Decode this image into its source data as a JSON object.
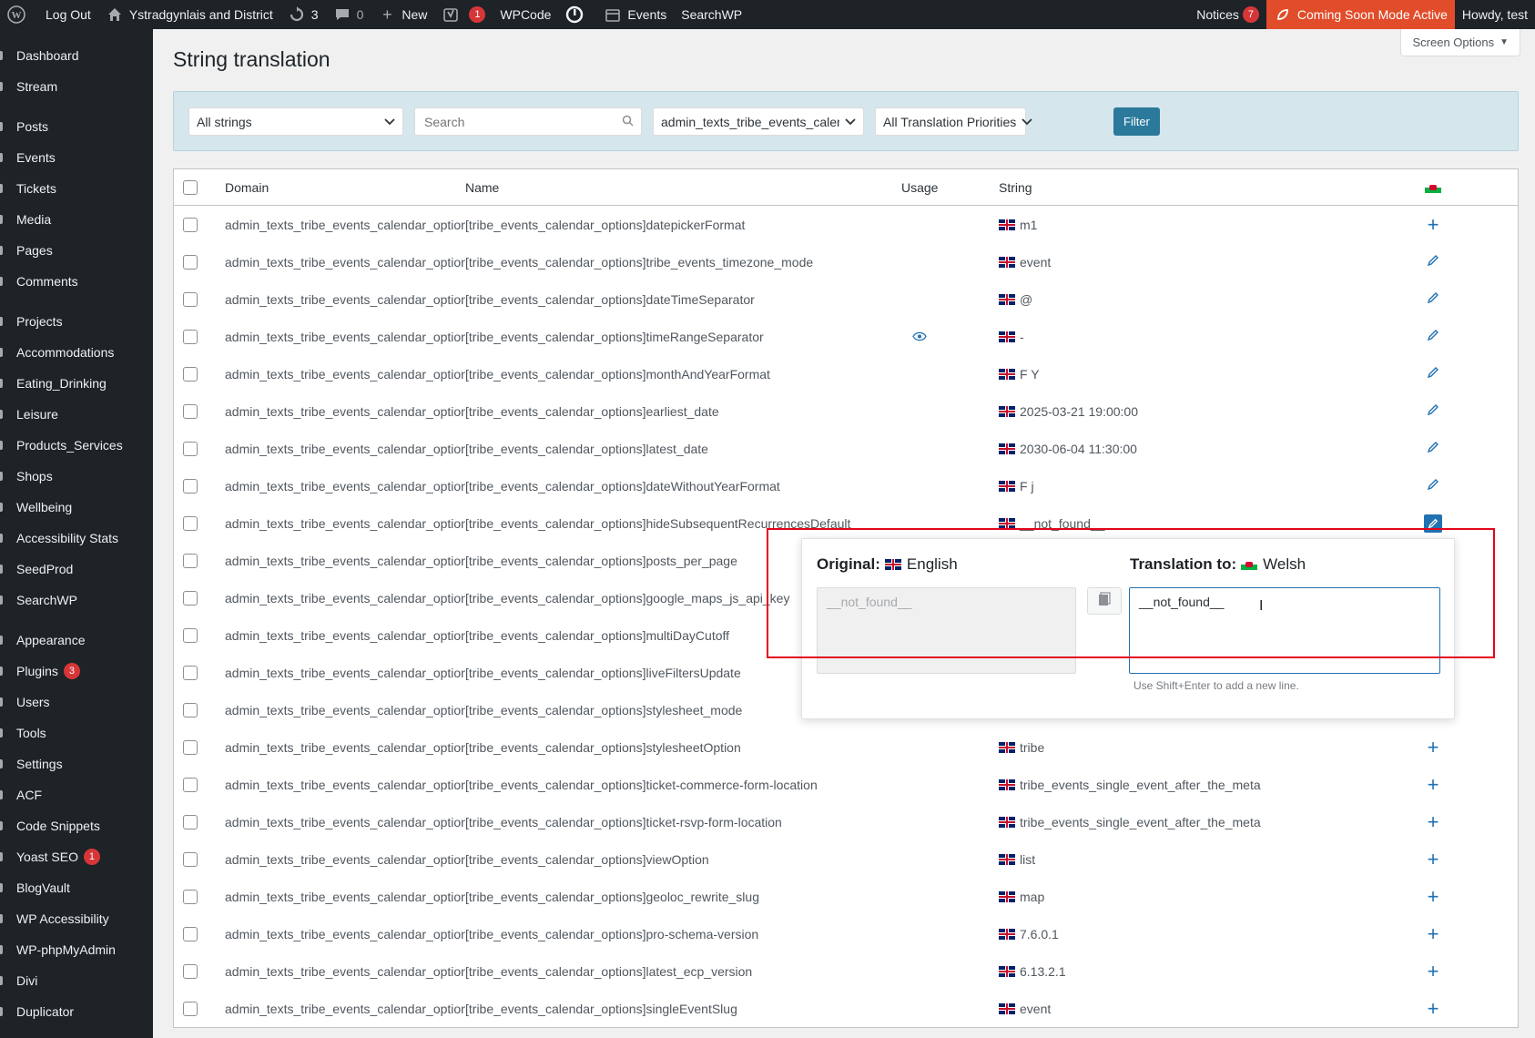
{
  "adminbar": {
    "logout": "Log Out",
    "site_name": "Ystradgynlais and District",
    "updates_count": "3",
    "comments_count": "0",
    "new_label": "New",
    "yoast_count": "1",
    "wpcode": "WPCode",
    "events": "Events",
    "searchwp": "SearchWP",
    "notices": "Notices",
    "notices_count": "7",
    "coming_soon": "Coming Soon Mode Active",
    "howdy": "Howdy, test"
  },
  "sidebar": {
    "items": [
      {
        "label": "Dashboard",
        "icon": "dashboard-icon"
      },
      {
        "label": "Stream",
        "icon": "stream-icon"
      },
      {
        "label": "Posts",
        "icon": "pin-icon"
      },
      {
        "label": "Events",
        "icon": "pin-icon"
      },
      {
        "label": "Tickets",
        "icon": "pin-icon"
      },
      {
        "label": "Media",
        "icon": "media-icon"
      },
      {
        "label": "Pages",
        "icon": "pages-icon"
      },
      {
        "label": "Comments",
        "icon": "comments-icon"
      },
      {
        "label": "Projects",
        "icon": "pin-icon"
      },
      {
        "label": "Accommodations",
        "icon": "pin-icon"
      },
      {
        "label": "Eating_Drinking",
        "icon": "pin-icon"
      },
      {
        "label": "Leisure",
        "icon": "pin-icon"
      },
      {
        "label": "Products_Services",
        "icon": "pin-icon"
      },
      {
        "label": "Shops",
        "icon": "pin-icon"
      },
      {
        "label": "Wellbeing",
        "icon": "pin-icon"
      },
      {
        "label": "Accessibility Stats",
        "icon": "pin-icon"
      },
      {
        "label": "SeedProd",
        "icon": "seedprod-icon"
      },
      {
        "label": "SearchWP",
        "icon": "searchwp-icon"
      },
      {
        "label": "Appearance",
        "icon": "appearance-icon"
      },
      {
        "label": "Plugins",
        "icon": "plugins-icon",
        "badge": "3"
      },
      {
        "label": "Users",
        "icon": "users-icon"
      },
      {
        "label": "Tools",
        "icon": "tools-icon"
      },
      {
        "label": "Settings",
        "icon": "settings-icon"
      },
      {
        "label": "ACF",
        "icon": "acf-icon"
      },
      {
        "label": "Code Snippets",
        "icon": "code-snippets-icon"
      },
      {
        "label": "Yoast SEO",
        "icon": "yoast-icon",
        "badge": "1"
      },
      {
        "label": "BlogVault",
        "icon": "blogvault-icon"
      },
      {
        "label": "WP Accessibility",
        "icon": "accessibility-icon"
      },
      {
        "label": "WP-phpMyAdmin",
        "icon": "phpmyadmin-icon"
      },
      {
        "label": "Divi",
        "icon": "divi-icon"
      },
      {
        "label": "Duplicator",
        "icon": "duplicator-icon"
      }
    ]
  },
  "page": {
    "title": "String translation",
    "screen_options": "Screen Options"
  },
  "filters": {
    "strings_select": "All strings",
    "search_placeholder": "Search",
    "domain_select": "admin_texts_tribe_events_calendar_",
    "priority_select": "All Translation Priorities",
    "filter_button": "Filter"
  },
  "table": {
    "headers": {
      "domain": "Domain",
      "name": "Name",
      "usage": "Usage",
      "string": "String"
    },
    "rows": [
      {
        "domain": "admin_texts_tribe_events_calendar_options",
        "name": "[tribe_events_calendar_options]datepickerFormat",
        "string": "m1",
        "action": "add"
      },
      {
        "domain": "admin_texts_tribe_events_calendar_options",
        "name": "[tribe_events_calendar_options]tribe_events_timezone_mode",
        "string": "event",
        "action": "edit"
      },
      {
        "domain": "admin_texts_tribe_events_calendar_options",
        "name": "[tribe_events_calendar_options]dateTimeSeparator",
        "string": "@",
        "action": "edit"
      },
      {
        "domain": "admin_texts_tribe_events_calendar_options",
        "name": "[tribe_events_calendar_options]timeRangeSeparator",
        "string": "-",
        "action": "edit",
        "usage": true
      },
      {
        "domain": "admin_texts_tribe_events_calendar_options",
        "name": "[tribe_events_calendar_options]monthAndYearFormat",
        "string": "F Y",
        "action": "edit"
      },
      {
        "domain": "admin_texts_tribe_events_calendar_options",
        "name": "[tribe_events_calendar_options]earliest_date",
        "string": "2025-03-21 19:00:00",
        "action": "edit"
      },
      {
        "domain": "admin_texts_tribe_events_calendar_options",
        "name": "[tribe_events_calendar_options]latest_date",
        "string": "2030-06-04 11:30:00",
        "action": "edit"
      },
      {
        "domain": "admin_texts_tribe_events_calendar_options",
        "name": "[tribe_events_calendar_options]dateWithoutYearFormat",
        "string": "F j",
        "action": "edit"
      },
      {
        "domain": "admin_texts_tribe_events_calendar_options",
        "name": "[tribe_events_calendar_options]hideSubsequentRecurrencesDefault",
        "string": "__not_found__",
        "action": "edit-active"
      },
      {
        "domain": "admin_texts_tribe_events_calendar_options",
        "name": "[tribe_events_calendar_options]posts_per_page",
        "string": "",
        "action": ""
      },
      {
        "domain": "admin_texts_tribe_events_calendar_options",
        "name": "[tribe_events_calendar_options]google_maps_js_api_key",
        "string": "",
        "action": ""
      },
      {
        "domain": "admin_texts_tribe_events_calendar_options",
        "name": "[tribe_events_calendar_options]multiDayCutoff",
        "string": "",
        "action": ""
      },
      {
        "domain": "admin_texts_tribe_events_calendar_options",
        "name": "[tribe_events_calendar_options]liveFiltersUpdate",
        "string": "",
        "action": ""
      },
      {
        "domain": "admin_texts_tribe_events_calendar_options",
        "name": "[tribe_events_calendar_options]stylesheet_mode",
        "string": "",
        "action": ""
      },
      {
        "domain": "admin_texts_tribe_events_calendar_options",
        "name": "[tribe_events_calendar_options]stylesheetOption",
        "string": "tribe",
        "action": "add"
      },
      {
        "domain": "admin_texts_tribe_events_calendar_options",
        "name": "[tribe_events_calendar_options]ticket-commerce-form-location",
        "string": "tribe_events_single_event_after_the_meta",
        "action": "add"
      },
      {
        "domain": "admin_texts_tribe_events_calendar_options",
        "name": "[tribe_events_calendar_options]ticket-rsvp-form-location",
        "string": "tribe_events_single_event_after_the_meta",
        "action": "add"
      },
      {
        "domain": "admin_texts_tribe_events_calendar_options",
        "name": "[tribe_events_calendar_options]viewOption",
        "string": "list",
        "action": "add"
      },
      {
        "domain": "admin_texts_tribe_events_calendar_options",
        "name": "[tribe_events_calendar_options]geoloc_rewrite_slug",
        "string": "map",
        "action": "add"
      },
      {
        "domain": "admin_texts_tribe_events_calendar_options",
        "name": "[tribe_events_calendar_options]pro-schema-version",
        "string": "7.6.0.1",
        "action": "add"
      },
      {
        "domain": "admin_texts_tribe_events_calendar_options",
        "name": "[tribe_events_calendar_options]latest_ecp_version",
        "string": "6.13.2.1",
        "action": "add"
      },
      {
        "domain": "admin_texts_tribe_events_calendar_options",
        "name": "[tribe_events_calendar_options]singleEventSlug",
        "string": "event",
        "action": "add"
      }
    ]
  },
  "popup": {
    "original_label": "Original:",
    "original_lang": "English",
    "translation_label": "Translation to:",
    "translation_lang": "Welsh",
    "original_value": "__not_found__",
    "translation_value": "__not_found__",
    "hint": "Use Shift+Enter to add a new line."
  }
}
